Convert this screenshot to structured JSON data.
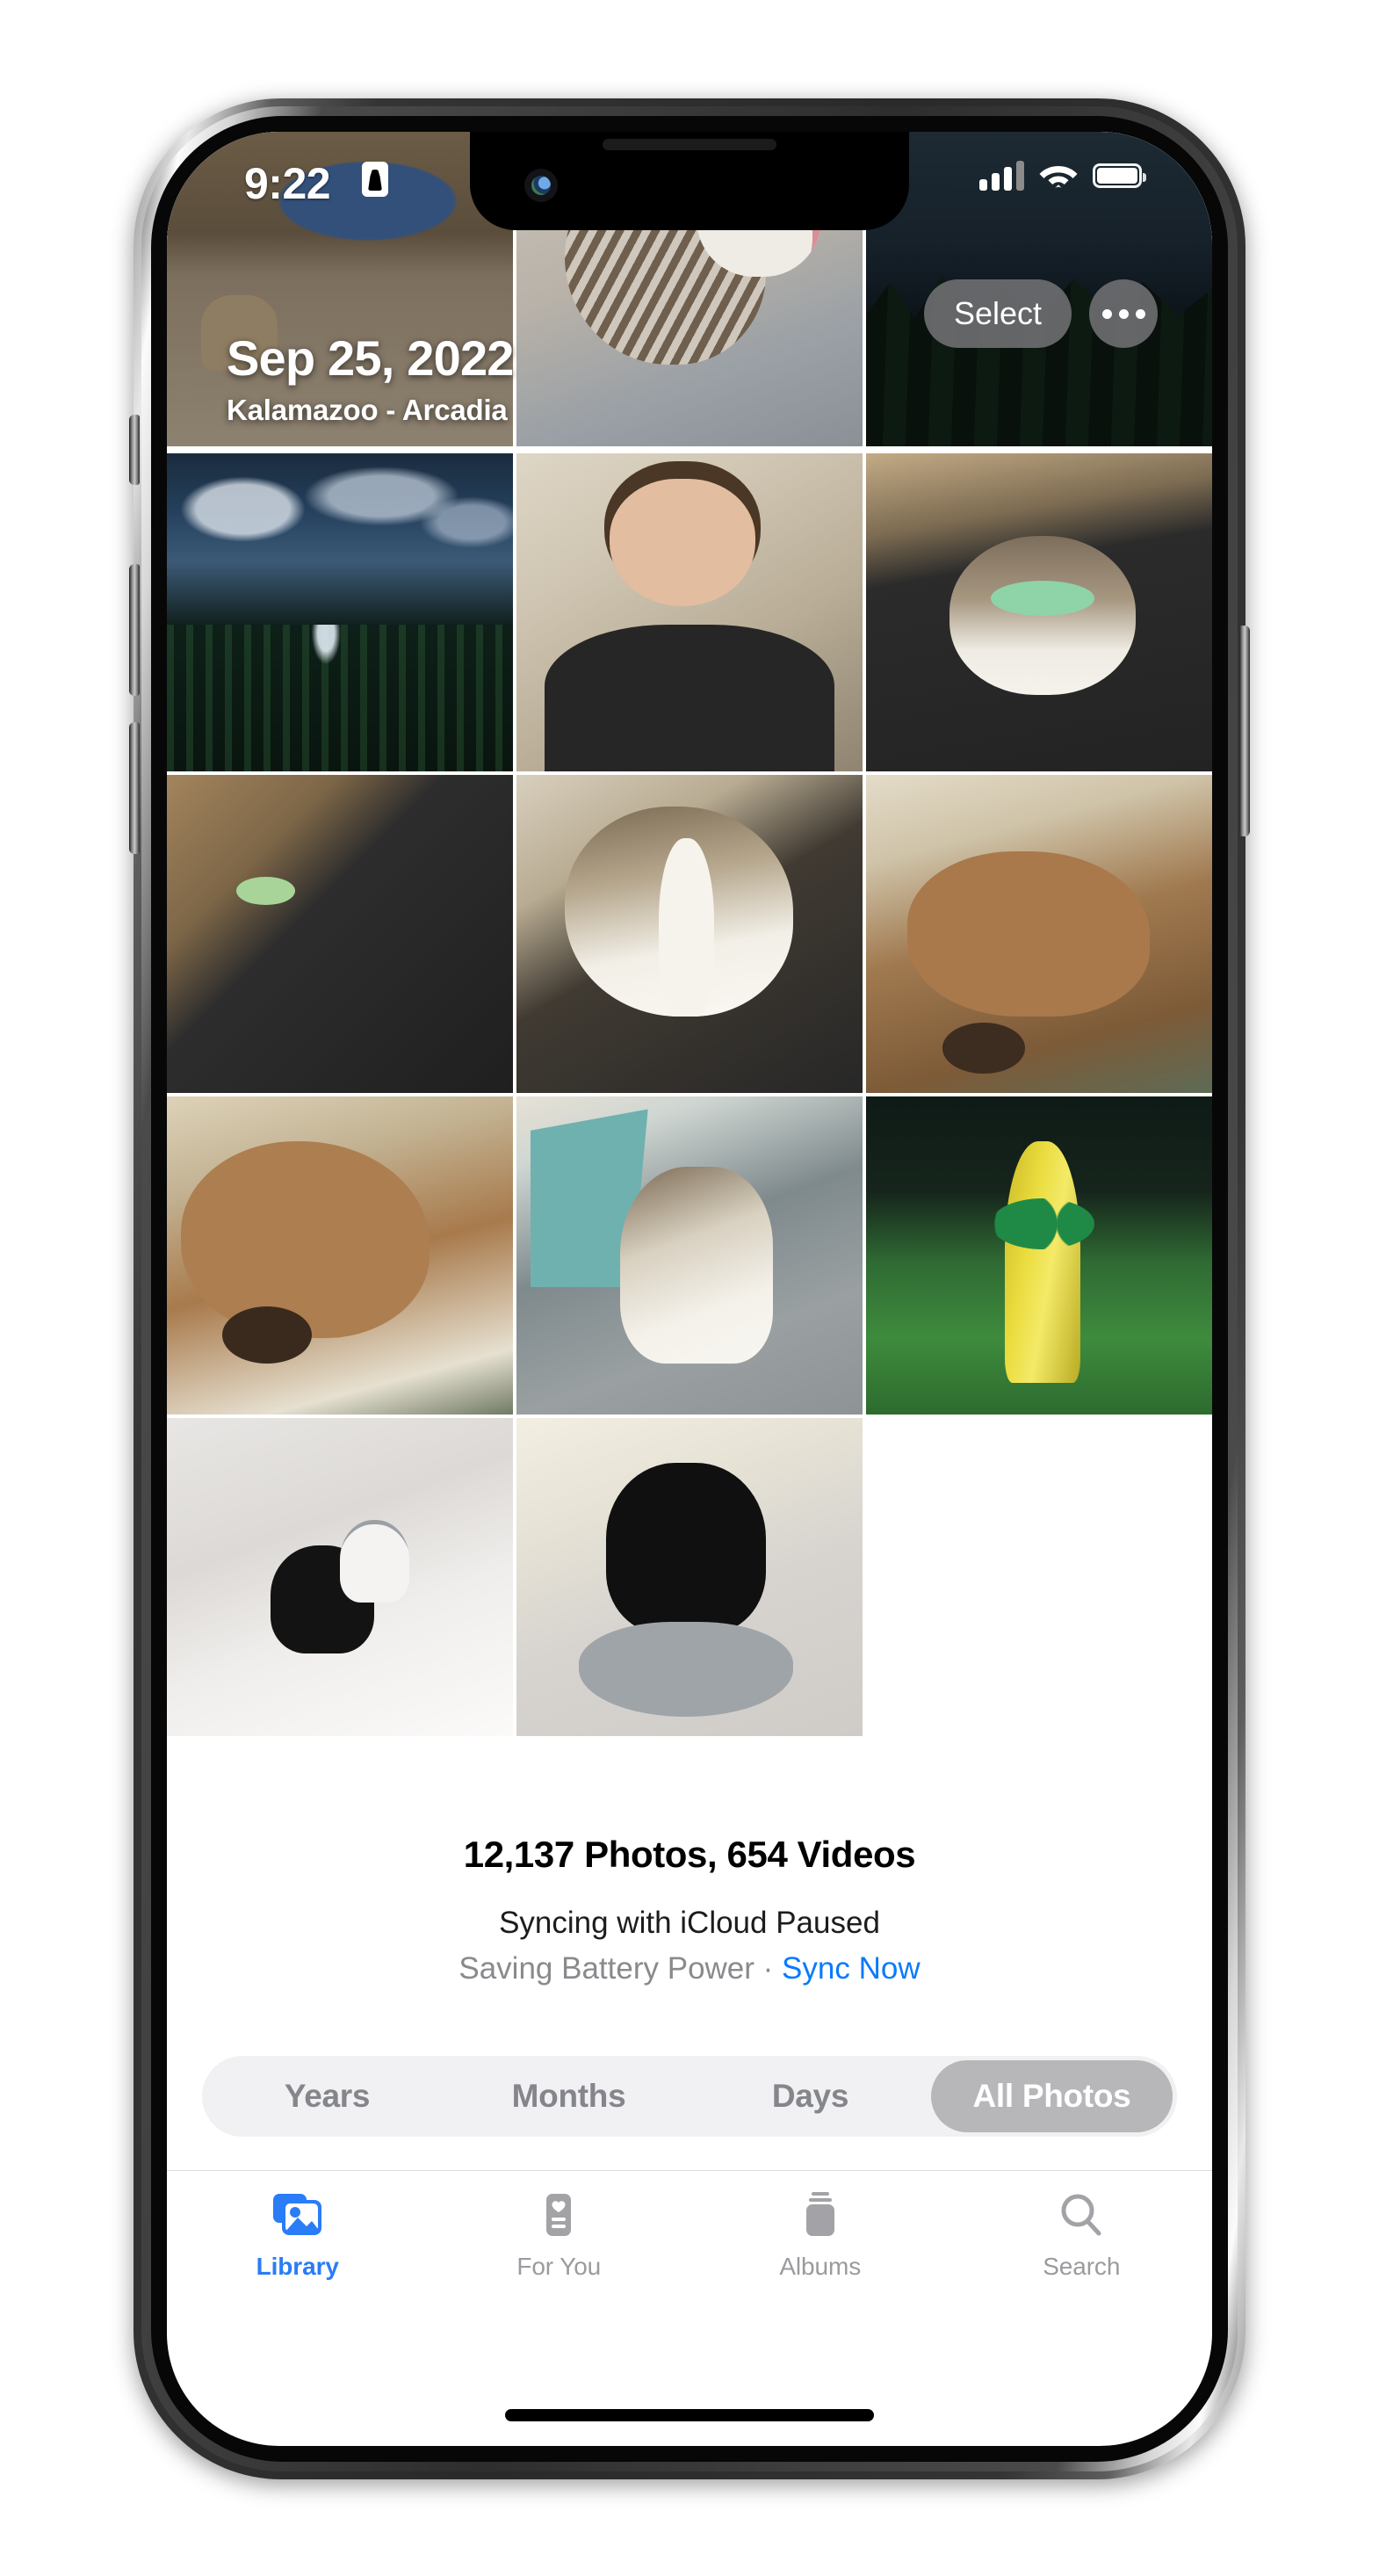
{
  "status_bar": {
    "time": "9:22",
    "record_icon": "contact-card-icon",
    "signal_icon": "cellular-signal-icon",
    "signal_bars_filled": 3,
    "signal_bars_total": 4,
    "wifi_icon": "wifi-icon",
    "battery_icon": "battery-full-icon",
    "battery_level_percent": 100
  },
  "header": {
    "date": "Sep 25, 2022",
    "location": "Kalamazoo - Arcadia",
    "select_label": "Select",
    "more_icon": "ellipsis-icon"
  },
  "grid": {
    "columns": 3,
    "photos": [
      {
        "id": "p1",
        "alt": "Living room with TV and game controller on carpet",
        "style": "t-livingroom"
      },
      {
        "id": "p2",
        "alt": "Tabby and white cat yawning on a grey blanket",
        "style": "t-catyawn"
      },
      {
        "id": "p3",
        "alt": "Dark trees at dusk in a park",
        "style": "t-trees-night"
      },
      {
        "id": "p4",
        "alt": "Night lake with fountain and cloudy sky",
        "style": "t-lake-night"
      },
      {
        "id": "p5",
        "alt": "Man smiling with cat paw on his chest",
        "style": "t-selfie-man"
      },
      {
        "id": "p6",
        "alt": "Tabby cat held against black shirt looking at camera",
        "style": "t-cat-shirt"
      },
      {
        "id": "p7",
        "alt": "Tabby and white cat in profile",
        "style": "t-cat-profile"
      },
      {
        "id": "p8",
        "alt": "Cat with paw over its face",
        "style": "t-cat-paw"
      },
      {
        "id": "p9",
        "alt": "Brown dog resting head on a blanket",
        "style": "t-dog-bed"
      },
      {
        "id": "p10",
        "alt": "Close-up of brown dog lying on cream blanket",
        "style": "t-dog-closeup"
      },
      {
        "id": "p11",
        "alt": "Tabby and white cat sitting on grey couch with teal pillow",
        "style": "t-cat-couch"
      },
      {
        "id": "p12",
        "alt": "Yellow and green fire hydrant on grass at dusk",
        "style": "t-hydrant"
      },
      {
        "id": "p13",
        "alt": "Black cat on white dresser next to stormtrooper helmet",
        "style": "t-blackcat-dresser"
      },
      {
        "id": "p14",
        "alt": "Black cat sitting in a grey fuzzy cat bed",
        "style": "t-blackcat-bed"
      },
      {
        "id": "p15",
        "alt": "",
        "style": "empty"
      }
    ]
  },
  "footer": {
    "photo_count": "12,137 Photos, 654 Videos",
    "sync_status": "Syncing with iCloud Paused",
    "sync_detail_prefix": "Saving Battery Power",
    "sync_detail_separator": " · ",
    "sync_now_label": "Sync Now"
  },
  "segmented_control": {
    "selected": "All Photos",
    "options": [
      {
        "label": "Years",
        "active": false
      },
      {
        "label": "Months",
        "active": false
      },
      {
        "label": "Days",
        "active": false
      },
      {
        "label": "All Photos",
        "active": true
      }
    ]
  },
  "tab_bar": {
    "tabs": [
      {
        "label": "Library",
        "icon": "photo-stack-icon",
        "active": true
      },
      {
        "label": "For You",
        "icon": "memories-card-icon",
        "active": false
      },
      {
        "label": "Albums",
        "icon": "albums-stack-icon",
        "active": false
      },
      {
        "label": "Search",
        "icon": "magnifier-icon",
        "active": false
      }
    ]
  },
  "colors": {
    "accent": "#2a7cf7",
    "link": "#0a7aff",
    "segment_active_bg": "#b7b7b9",
    "segment_track_bg": "#f1f1f3",
    "inactive_label": "#9b9b9f",
    "muted_text": "#8a8a8e"
  },
  "home_indicator": "home-indicator"
}
